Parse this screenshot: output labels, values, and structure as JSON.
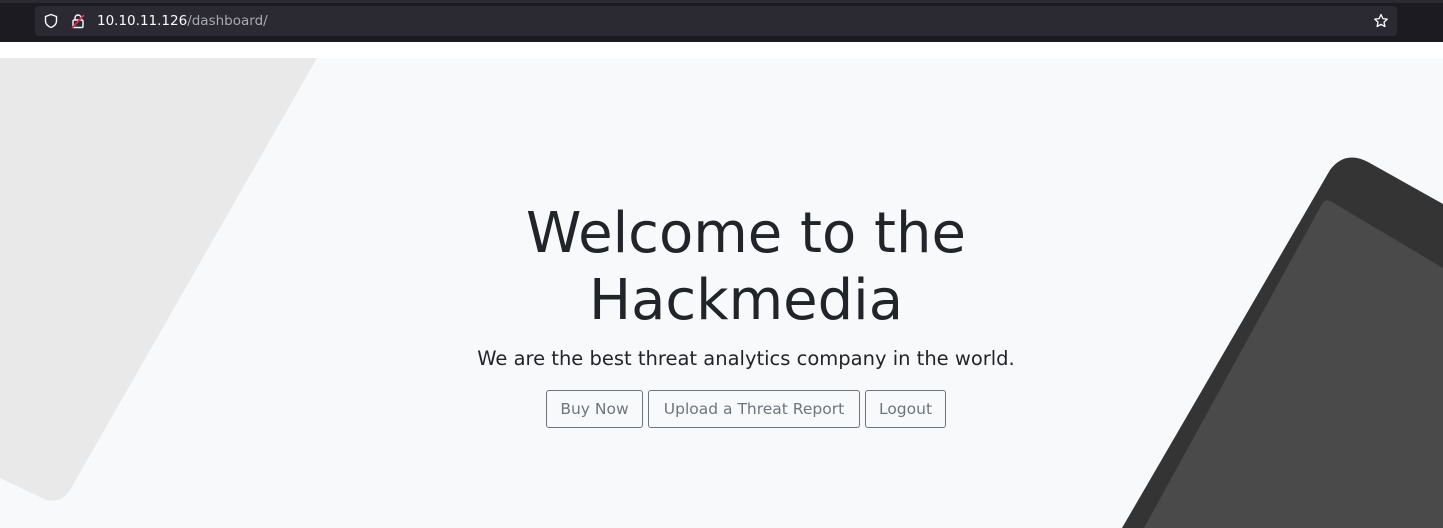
{
  "browser": {
    "url_host": "10.10.11.126",
    "url_path": "/dashboard/",
    "icons": [
      "shield-icon",
      "lock-icon",
      "star-icon"
    ]
  },
  "hero": {
    "title_line1": "Welcome to the",
    "title_line2": "Hackmedia",
    "subtitle": "We are the best threat analytics company in the world.",
    "buttons": {
      "buy": "Buy Now",
      "upload": "Upload a Threat Report",
      "logout": "Logout"
    }
  },
  "colors": {
    "page_background": "#f8f9fa",
    "text": "#212529",
    "button_outline": "#6c757d",
    "chrome_background": "#1c1b22",
    "urlbar_background": "#2b2a33"
  }
}
